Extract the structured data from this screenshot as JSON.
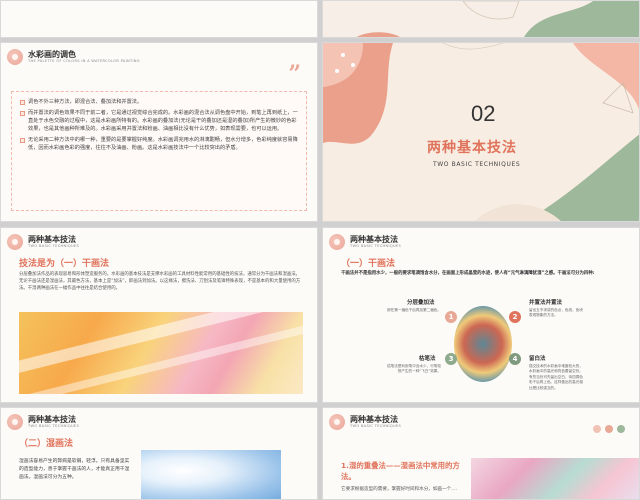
{
  "slide0": {},
  "slide1": {},
  "slide2": {
    "title": "水彩画的调色",
    "subtitle": "THE PALETTE OF COLORS IN A WATERCOLOR PAINTING",
    "quote": "”",
    "paragraphs": [
      "调色不外三种方法，即混合法、叠加法和并置法。",
      "而并置法的调色效果不同于前二者，它是通过视觉综合完成的。水彩画的混合法从调色盘中开始，到笔上再到纸上，一直处于水色交融的过程中，这是水彩画所特有的。水彩画的叠加法(无论是干的叠加还是湿的叠加)所产生的微妙的色彩效果，也是其他画种所难及的。水彩画采用并置法和粉画、油画相比没有什么优势，如表现需要，也可以运用。",
      "无论采用二种方法中的哪一种，重要的是要掌握好纯度。水彩画调完用水的淋漓酣畅，但水分增多，色彩纯度就容易降低，因而水彩画色彩的强度，往往不及油画、粉画。这是水彩画技法中一个比较突出的矛盾。"
    ]
  },
  "slide3": {
    "number": "02",
    "title": "两种基本技法",
    "subtitle": "TWO BASIC TECHNIQUES"
  },
  "slide4": {
    "title": "两种基本技法",
    "subtitle": "TWO BASIC TECHNIQUES",
    "heading": "技法是为（一）干画法",
    "body": "分层叠加法作品的表现容易和形体塑造服务的。水彩画的基本技法是支撑水彩画的工具材料性能常用的基础性的技法，通常分为干画法和湿画法。无论干画法还是湿画法，其最色方法，基本上是“加法”，即画法到加法。以这缘法，擦洗法、刀刮法及笔锋特殊表现，不是基本的和大量使用的方法。干湿两种画法在一幅作品中往往是结合使用的。"
  },
  "slide5": {
    "title": "两种基本技法",
    "subtitle": "TWO BASIC TECHNIQUES",
    "heading": "（一）干画法",
    "intro": "干画法并不是指用水少，一般的要求笔调饱含水分，在画面上形成晶莹的水迹，使人有“元气淋漓障犹湿”之感。干画法可分为四种:",
    "items": [
      {
        "num": "1",
        "title": "分层叠加法",
        "desc": "即在第一遍色干后再加第二遍色。"
      },
      {
        "num": "2",
        "title": "并置法并置法",
        "desc": "留出五不求讲的色点，色线、色块表现物象的方法。"
      },
      {
        "num": "3",
        "title": "枯笔法",
        "desc": "枯笔法是利用笔中含水少，行笔较快产生的一种“飞白”效果。"
      },
      {
        "num": "4",
        "title": "留白法",
        "desc": "描交技术的水彩画中难度较大的，水彩画中的高光和亮色要留空处。有些当处可先留出空白，待四周色彩干后再上色。这样做出的高光相比是比较强当的。"
      }
    ],
    "colors": {
      "c1": "#e8a896",
      "c2": "#e0735b",
      "c3": "#8daa8c",
      "c4": "#7f9a7e"
    }
  },
  "slide6": {
    "title": "两种基本技法",
    "subtitle": "TWO BASIC TECHNIQUES",
    "heading": "（二）湿画法",
    "body": "湿画法容易产生的弊病是软弱，轻浮。只有具备坚实的造型能力，善于掌握干画法的人，才能真正用干湿画法。湿画法可分为五种。"
  },
  "slide7": {
    "title": "两种基本技法",
    "subtitle": "TWO BASIC TECHNIQUES",
    "heading": "1.湿的重叠法——湿画法中常用的方法。",
    "body": "它要求根据造型的需要，掌握好时间和水分，如画一个...."
  }
}
